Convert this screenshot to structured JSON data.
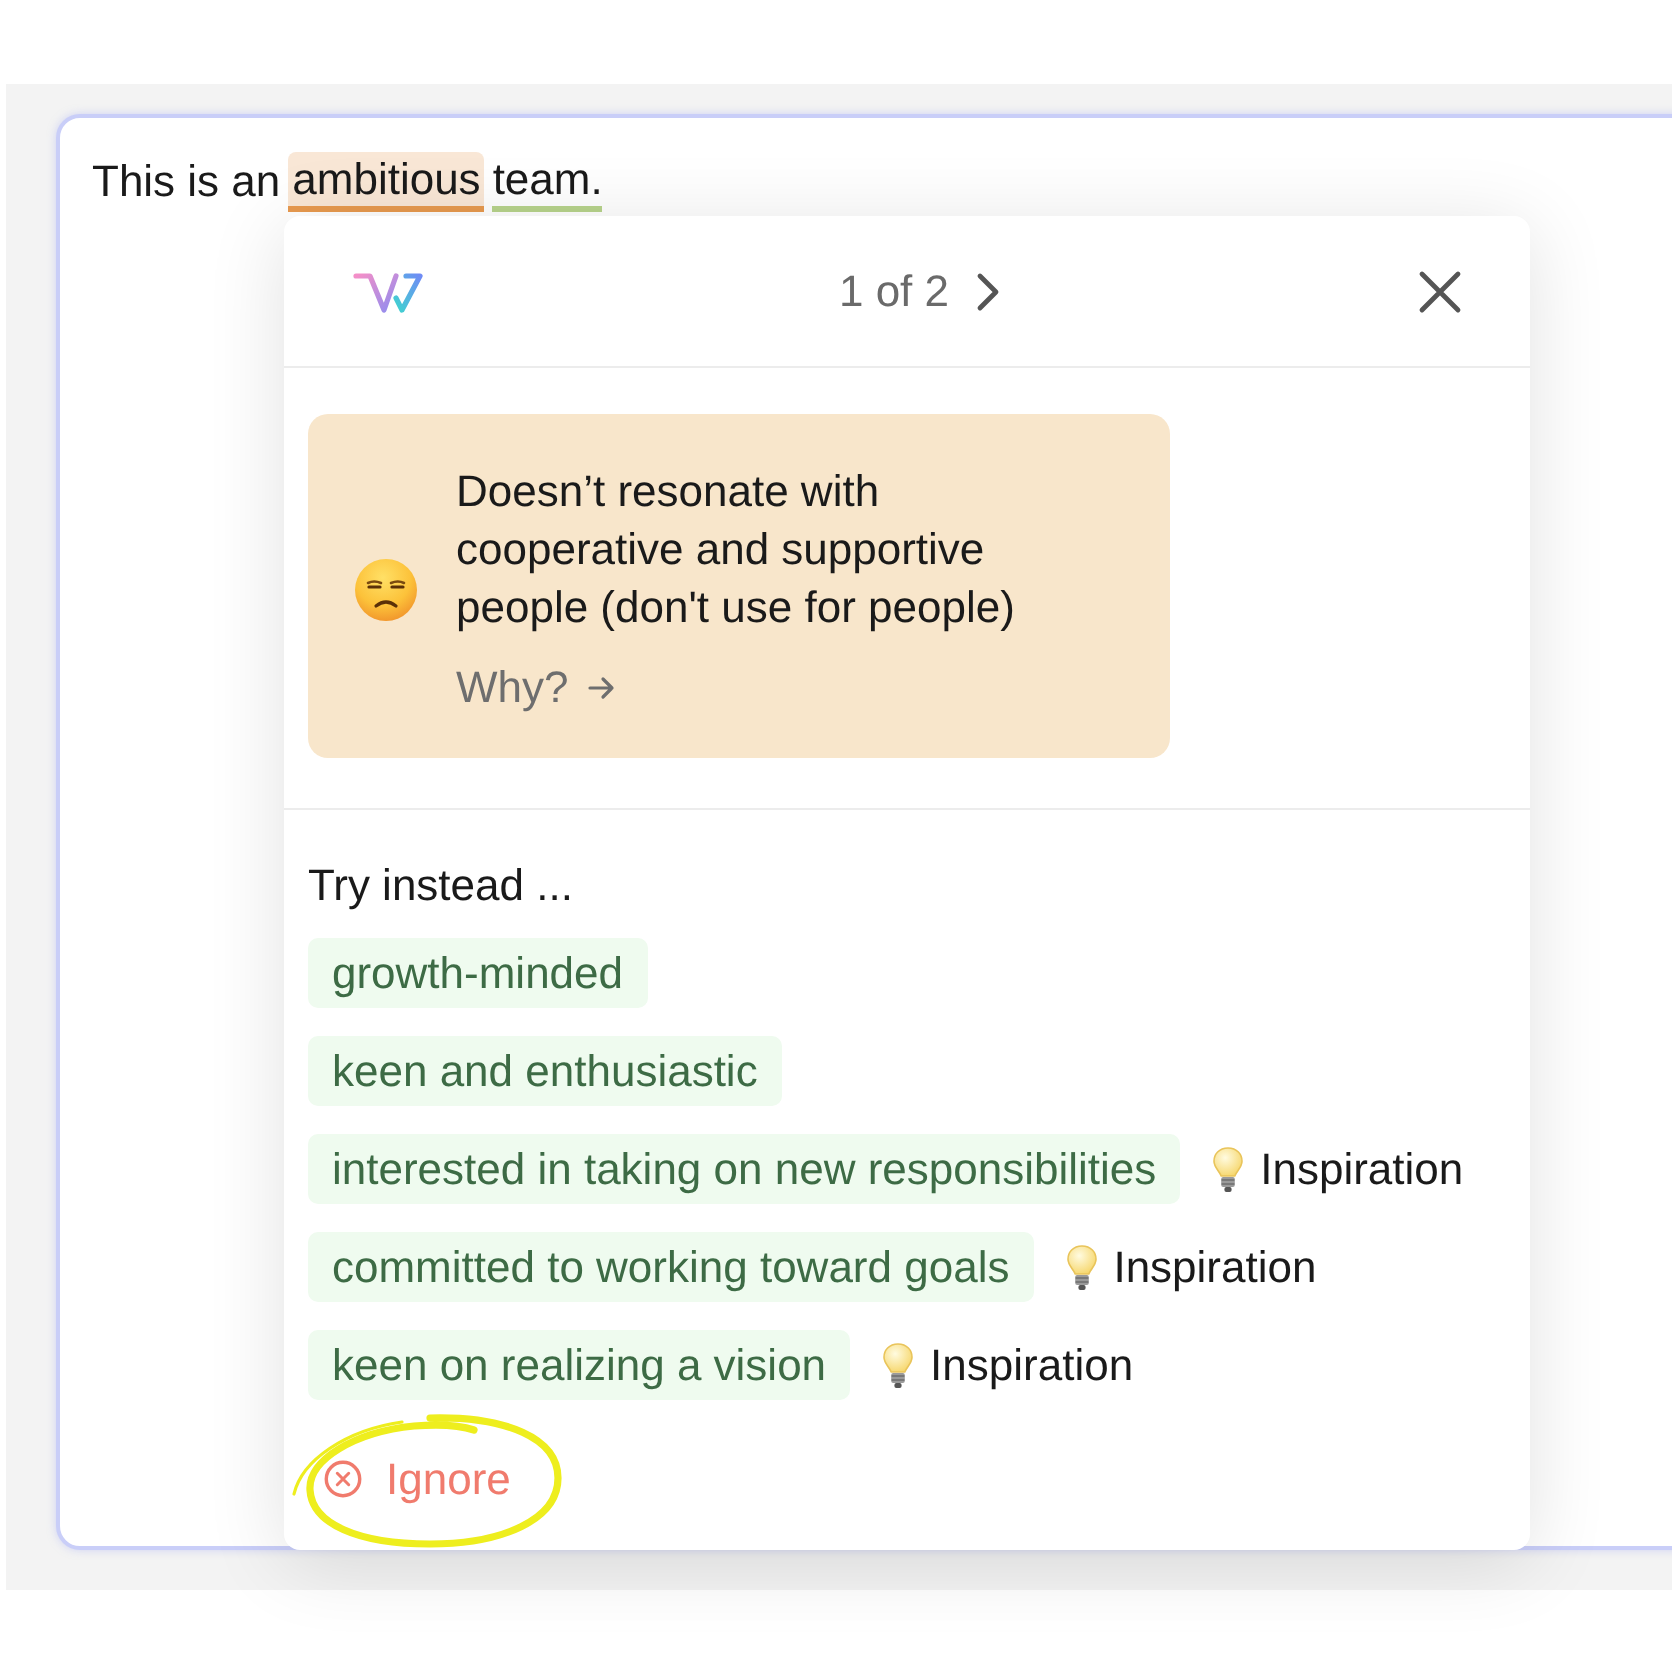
{
  "editor": {
    "segments": [
      {
        "text": "This is an",
        "kind": "plain"
      },
      {
        "text": "ambitious",
        "kind": "flagged"
      },
      {
        "text": "team.",
        "kind": "underlined"
      }
    ]
  },
  "popup": {
    "counter": "1 of 2",
    "issue": {
      "message": "Doesn’t resonate with cooperative and supportive people (don't use for people)",
      "link": "Why?"
    },
    "suggestions_heading": "Try instead ...",
    "suggestions": [
      {
        "text": "growth-minded"
      },
      {
        "text": "keen and enthusiastic"
      },
      {
        "text": "interested in taking on new responsibilities",
        "inspiration": "Inspiration"
      },
      {
        "text": "committed to working toward goals",
        "inspiration": "Inspiration"
      },
      {
        "text": "keen on realizing a vision",
        "inspiration": "Inspiration"
      }
    ],
    "ignore": "Ignore"
  }
}
